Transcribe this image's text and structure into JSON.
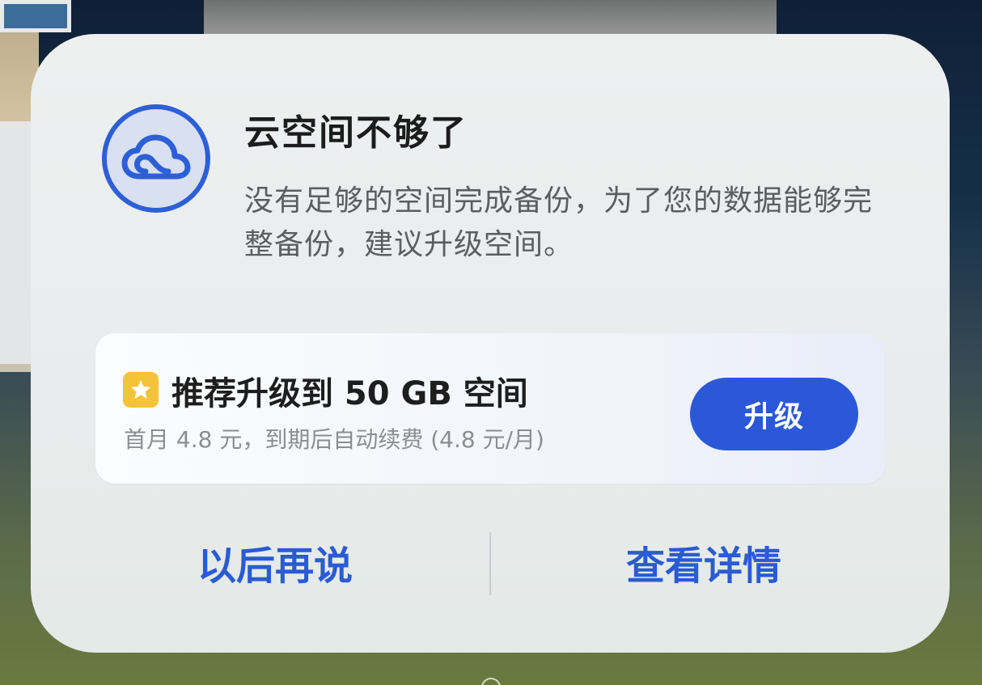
{
  "dialog": {
    "title": "云空间不够了",
    "message": "没有足够的空间完成备份，为了您的数据能够完整备份，建议升级空间。",
    "app_icon": "cloud-icon"
  },
  "offer": {
    "badge_icon": "star-icon",
    "title": "推荐升级到 50 GB 空间",
    "subtitle": "首月 4.8 元，到期后自动续费 (4.8 元/月)",
    "button_label": "升级"
  },
  "actions": {
    "later_label": "以后再说",
    "details_label": "查看详情"
  },
  "colors": {
    "accent": "#2a58d9",
    "badge": "#f5c33a",
    "title_text": "#1c1c1c",
    "secondary_text": "#5b5e61"
  }
}
